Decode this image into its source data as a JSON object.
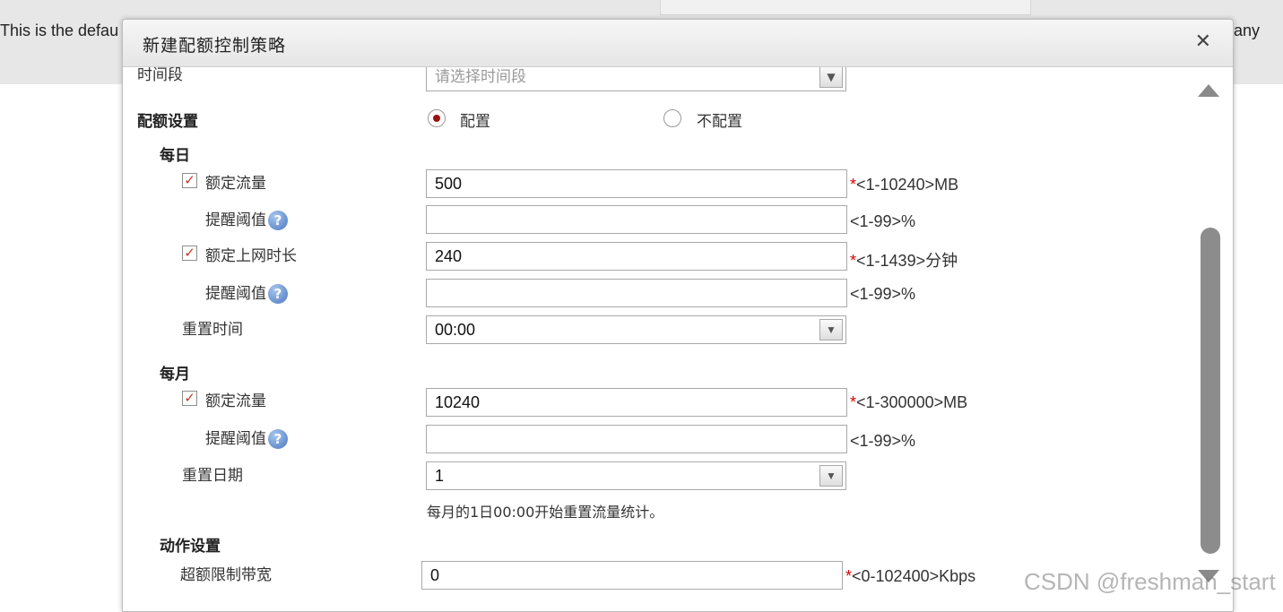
{
  "background": {
    "left_text": "This is the defau",
    "right_text": "any"
  },
  "dialog": {
    "title": "新建配额控制策略",
    "close_glyph": "✕"
  },
  "time_period": {
    "label": "时间段",
    "placeholder": "请选择时间段"
  },
  "quota_settings": {
    "label": "配额设置",
    "options": [
      {
        "label": "配置",
        "checked": true
      },
      {
        "label": "不配置",
        "checked": false
      }
    ]
  },
  "daily": {
    "heading": "每日",
    "quota_traffic": {
      "label": "额定流量",
      "checked": true,
      "value": "500",
      "required": "*",
      "hint": "<1-10240>MB"
    },
    "traffic_alert": {
      "label": "提醒阈值",
      "value": "",
      "hint": "<1-99>%"
    },
    "online_time": {
      "label": "额定上网时长",
      "checked": true,
      "value": "240",
      "required": "*",
      "hint": "<1-1439>分钟"
    },
    "time_alert": {
      "label": "提醒阈值",
      "value": "",
      "hint": "<1-99>%"
    },
    "reset_time": {
      "label": "重置时间",
      "value": "00:00"
    }
  },
  "monthly": {
    "heading": "每月",
    "quota_traffic": {
      "label": "额定流量",
      "checked": true,
      "value": "10240",
      "required": "*",
      "hint": "<1-300000>MB"
    },
    "traffic_alert": {
      "label": "提醒阈值",
      "value": "",
      "hint": "<1-99>%"
    },
    "reset_date": {
      "label": "重置日期",
      "value": "1",
      "note": "每月的1日00:00开始重置流量统计。"
    }
  },
  "action_settings": {
    "heading": "动作设置",
    "over_limit_bandwidth": {
      "label": "超额限制带宽",
      "value": "0",
      "required": "*",
      "hint": "<0-102400>Kbps"
    }
  },
  "help_glyph": "?",
  "check_glyph": "✓",
  "select_arrow_glyph": "▼",
  "watermark": "CSDN @freshman_start",
  "colors": {
    "required": "#dd0000",
    "check": "#c0392b",
    "radio_dot": "#9b0f0f",
    "help": "#4a78c0"
  }
}
